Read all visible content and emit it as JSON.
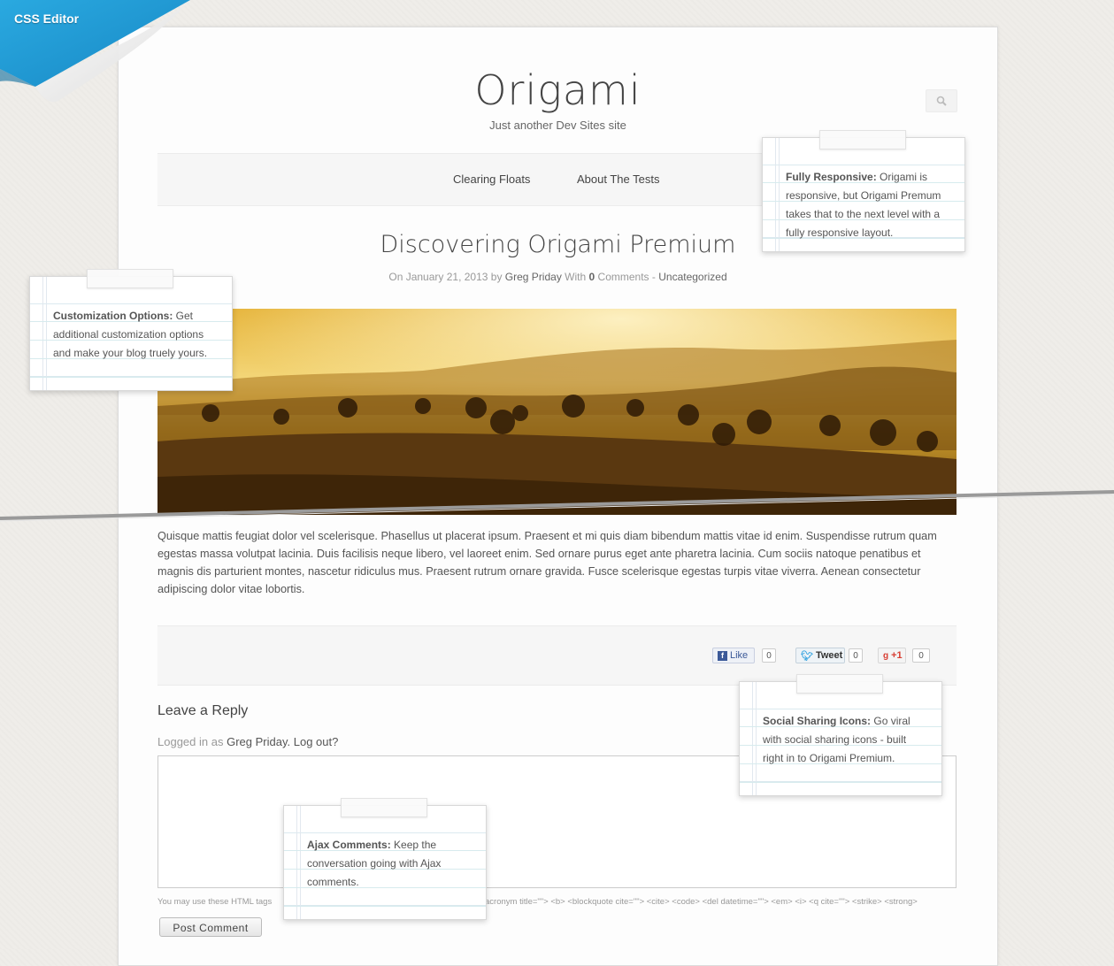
{
  "editor": {
    "label": "CSS Editor"
  },
  "site": {
    "title": "Origami",
    "tagline": "Just another Dev Sites site"
  },
  "nav": {
    "items": [
      {
        "label": "Clearing Floats"
      },
      {
        "label": "About The Tests"
      }
    ]
  },
  "post": {
    "title": "Discovering Origami Premium",
    "meta": {
      "prefix": "On January 21, 2013 by",
      "author": "Greg Priday",
      "with": "With",
      "comments_count": "0",
      "comments_label": "Comments -",
      "category": "Uncategorized"
    },
    "body": "Quisque mattis feugiat dolor vel scelerisque. Phasellus ut placerat ipsum. Praesent et mi quis diam bibendum mattis vitae id enim. Suspendisse rutrum quam egestas massa volutpat lacinia. Duis facilisis neque libero, vel laoreet enim. Sed ornare purus eget ante pharetra lacinia. Cum sociis natoque penatibus et magnis dis parturient montes, nascetur ridiculus mus. Praesent rutrum ornare gravida. Fusce scelerisque egestas turpis vitae viverra. Aenean consectetur adipiscing dolor vitae lobortis."
  },
  "share": {
    "like": {
      "label": "Like",
      "count": "0"
    },
    "tweet": {
      "label": "Tweet",
      "count": "0"
    },
    "plusone": {
      "label": "+1",
      "count": "0"
    }
  },
  "reply": {
    "title": "Leave a Reply",
    "logged_prefix": "Logged in as",
    "user": "Greg Priday",
    "logout": "Log out?",
    "html_tags_left": "You may use these HTML tags",
    "html_tags_right": "acronym title=\"\"> <b> <blockquote cite=\"\"> <cite> <code> <del datetime=\"\"> <em> <i> <q cite=\"\"> <strike> <strong>",
    "submit": "Post Comment"
  },
  "notes": {
    "responsive": {
      "title": "Fully Responsive:",
      "text": "Origami is responsive, but Origami Premum takes that to the next level with a fully responsive layout."
    },
    "customization": {
      "title": "Customization Options:",
      "text": "Get additional customization options and make your blog truely yours."
    },
    "social": {
      "title": "Social Sharing Icons:",
      "text": "Go viral with social sharing icons - built right in to Origami Premium."
    },
    "ajax": {
      "title": "Ajax Comments:",
      "text": "Keep the conversation going with Ajax comments."
    }
  },
  "colors": {
    "editor_corner": "#1a9fd8",
    "page_bg": "#efede9",
    "tear_line": "#9a9a9a"
  }
}
